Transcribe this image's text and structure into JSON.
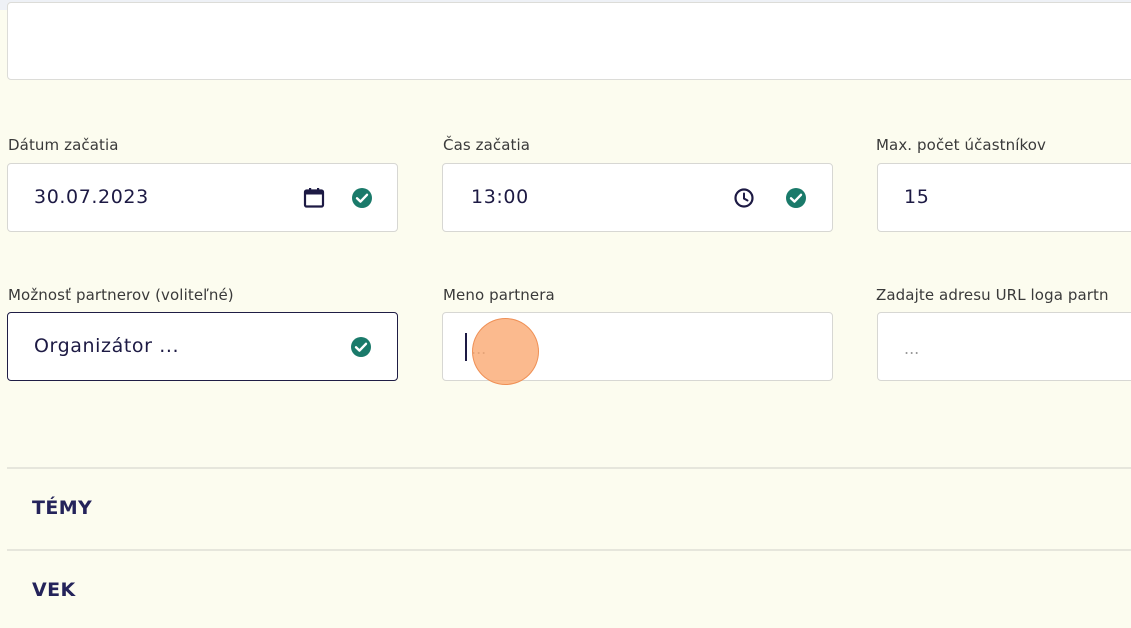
{
  "colors": {
    "accent_check": "#1a7a6a",
    "text_dark": "#1d1a44",
    "background": "#fcfcef"
  },
  "fields": {
    "start_date": {
      "label": "Dátum začatia",
      "value": "30.07.2023",
      "icon": "calendar-icon",
      "valid": true
    },
    "start_time": {
      "label": "Čas začatia",
      "value": "13:00",
      "icon": "clock-icon",
      "valid": true
    },
    "max_participants": {
      "label": "Max. počet účastníkov",
      "value": "15"
    },
    "partner_option": {
      "label": "Možnosť partnerov (voliteľné)",
      "value": "Organizátor ...",
      "valid": true
    },
    "partner_name": {
      "label": "Meno partnera",
      "placeholder": "..."
    },
    "partner_logo_url": {
      "label": "Zadajte adresu URL loga partn",
      "placeholder": "..."
    }
  },
  "sections": {
    "topics": "TÉMY",
    "age": "VEK"
  }
}
